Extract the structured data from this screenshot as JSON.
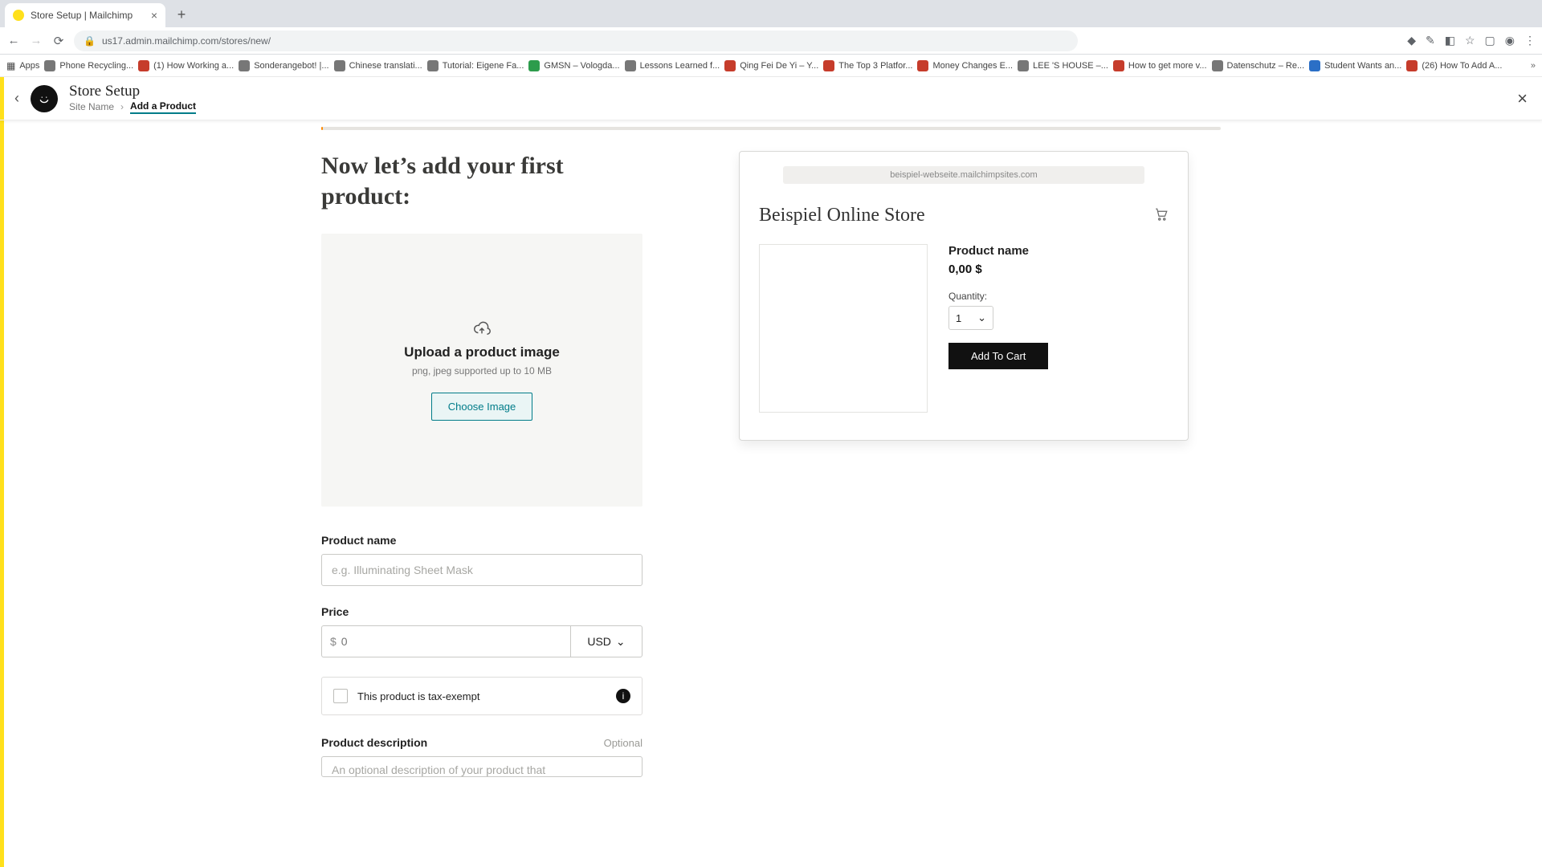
{
  "browser": {
    "tab_title": "Store Setup | Mailchimp",
    "url": "us17.admin.mailchimp.com/stores/new/",
    "bookmarks_label": "Apps",
    "bookmarks": [
      {
        "fav": "gr",
        "label": "Phone Recycling..."
      },
      {
        "fav": "",
        "label": "(1) How Working a..."
      },
      {
        "fav": "gr",
        "label": "Sonderangebot! |..."
      },
      {
        "fav": "gr",
        "label": "Chinese translati..."
      },
      {
        "fav": "gr",
        "label": "Tutorial: Eigene Fa..."
      },
      {
        "fav": "g",
        "label": "GMSN – Vologda..."
      },
      {
        "fav": "gr",
        "label": "Lessons Learned f..."
      },
      {
        "fav": "",
        "label": "Qing Fei De Yi – Y..."
      },
      {
        "fav": "",
        "label": "The Top 3 Platfor..."
      },
      {
        "fav": "",
        "label": "Money Changes E..."
      },
      {
        "fav": "gr",
        "label": "LEE 'S HOUSE –..."
      },
      {
        "fav": "",
        "label": "How to get more v..."
      },
      {
        "fav": "gr",
        "label": "Datenschutz – Re..."
      },
      {
        "fav": "b",
        "label": "Student Wants an..."
      },
      {
        "fav": "",
        "label": "(26) How To Add A..."
      }
    ]
  },
  "header": {
    "title": "Store Setup",
    "crumb1": "Site Name",
    "crumb2": "Add a Product"
  },
  "main": {
    "heading": "Now let’s add your first product:",
    "upload": {
      "title": "Upload a product image",
      "sub": "png, jpeg supported up to 10 MB",
      "button": "Choose Image"
    },
    "fields": {
      "name_label": "Product name",
      "name_placeholder": "e.g. Illuminating Sheet Mask",
      "price_label": "Price",
      "price_placeholder": "0",
      "price_symbol": "$",
      "currency": "USD",
      "tax_label": "This product is tax-exempt",
      "desc_label": "Product description",
      "desc_optional": "Optional",
      "desc_placeholder": "An optional description of your product that"
    }
  },
  "preview": {
    "url": "beispiel-webseite.mailchimpsites.com",
    "store_title": "Beispiel Online Store",
    "product_name": "Product name",
    "price": "0,00 $",
    "qty_label": "Quantity:",
    "qty_value": "1",
    "add_cart": "Add To Cart"
  }
}
